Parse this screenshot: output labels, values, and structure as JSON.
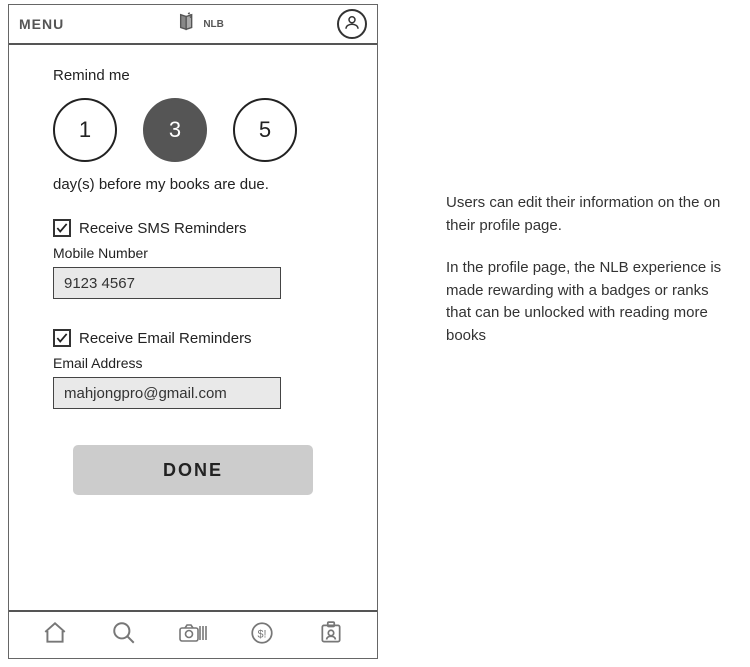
{
  "topbar": {
    "menu_label": "MENU",
    "logo_text": "NLB"
  },
  "reminder": {
    "label_top": "Remind me",
    "options": [
      "1",
      "3",
      "5"
    ],
    "selected_index": 1,
    "label_bottom": "day(s) before my books are due."
  },
  "sms": {
    "checkbox_label": "Receive SMS Reminders",
    "field_label": "Mobile Number",
    "value": "9123 4567"
  },
  "email": {
    "checkbox_label": "Receive Email Reminders",
    "field_label": "Email Address",
    "value": "mahjongpro@gmail.com"
  },
  "done_label": "DONE",
  "side": {
    "p1": "Users can edit their information on the on their profile page.",
    "p2": "In the profile page, the NLB experience is made rewarding with a badges or ranks that can be unlocked with reading more books"
  }
}
